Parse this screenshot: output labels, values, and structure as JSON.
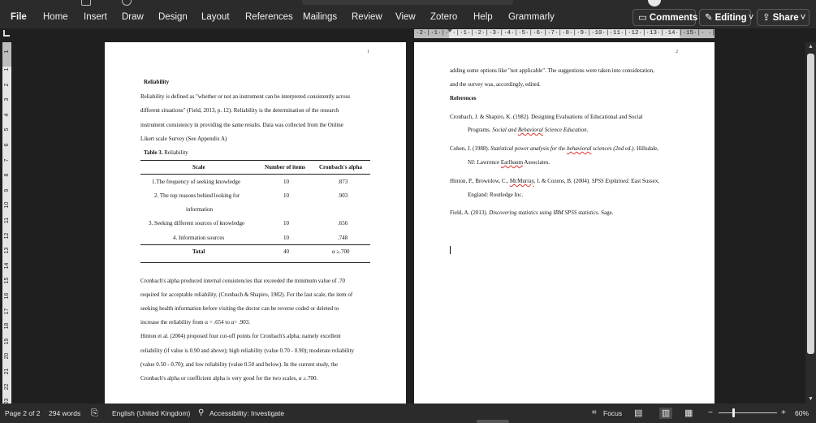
{
  "ribbon": {
    "tabs": [
      "File",
      "Home",
      "Insert",
      "Draw",
      "Design",
      "Layout",
      "References",
      "Mailings",
      "Review",
      "View",
      "Zotero",
      "Help",
      "Grammarly"
    ],
    "comments_label": "Comments",
    "editing_label": "Editing",
    "share_label": "Share"
  },
  "ruler": {
    "horizontal": "·2·|·1·|·   ·|·1·|·2·|·3·|·4·|·5·|·6·|·7·|·8·|·9·|·10·|·11·|·12·|·13·|·14·|·15·|·  ·|·17·|·18",
    "vertical": [
      "1",
      "1",
      "2",
      "3",
      "4",
      "5",
      "6",
      "7",
      "8",
      "9",
      "10",
      "11",
      "12",
      "13",
      "14",
      "15",
      "16",
      "17",
      "18",
      "19",
      "20",
      "21",
      "22",
      "23"
    ]
  },
  "page1": {
    "page_number": "1",
    "heading": "Reliability",
    "para1": [
      "Reliability is defined as \"whether or not an instrument can be interpreted consistently across",
      "different situations\" (Field, 2013, p. 12).  Reliability is the determination of the research",
      "instrument consistency in providing the same results. Data was collected from the Online",
      "Likert scale Survey (See Appendix A)"
    ],
    "table_caption_bold": "Table 3.",
    "table_caption_rest": " Reliability",
    "table": {
      "headers": [
        "Scale",
        "Number of items",
        "Cronbach's alpha"
      ],
      "rows": [
        {
          "scale": "1.The frequency of seeking knowledge",
          "items": "10",
          "alpha": ".873"
        },
        {
          "scale": "2. The top reasons behind looking for",
          "scale_cont": "information",
          "items": "10",
          "alpha": ".903"
        },
        {
          "scale": "3. Seeking different sources of knowledge",
          "items": "10",
          "alpha": ".656"
        },
        {
          "scale": "4. Information sources",
          "items": "10",
          "alpha": ".748"
        }
      ],
      "total": {
        "scale": "Total",
        "items": "40",
        "alpha": "α ≥.700"
      }
    },
    "para2": [
      "Cronbach's alpha produced internal consistencies that exceeded the minimum value of .70",
      "required for acceptable reliability, (Cronbach & Shapiro, 1982). For the last scale, the item of",
      "seeking health information before visiting the doctor can be reverse coded or deleted to",
      "increase the reliability from α = .654 to α= .903.",
      "Hinton et al. (2004) proposed four cut-off points for Cronbach's alpha; namely excellent",
      "reliability (if value is 0.90 and above); high reliability (value 0.70 - 0.90); moderate reliability",
      "(value 0.50 - 0.70); and low reliability (value 0.50 and below). In the current study, the",
      "Cronbach's alpha or coefficient alpha is very good for the two scales, α ≥.700."
    ]
  },
  "page2": {
    "page_number": "2",
    "top_lines": [
      "adding some options like \"not applicable\". The suggestions were taken into consideration,",
      "and the survey was, accordingly, edited."
    ],
    "references_heading": "References",
    "ref1": {
      "line1": "Cronbach, J. & Shapiro, K. (1982). Designing Evaluations of Educational and Social",
      "line2_a": "Programs. ",
      "line2_i1": "Social and ",
      "line2_sq": "Behavioral",
      "line2_i2": " Science Education."
    },
    "ref2": {
      "a": "Cohen, J. (1988). ",
      "i1": "Statistical power analysis for the ",
      "sq": "behavioral",
      "i2": " sciences (2nd ed.).",
      "b": " Hillsdale,",
      "line2_a": "NJ: Lawrence ",
      "line2_sq": "Earlbaum",
      "line2_b": " Associates."
    },
    "ref3": {
      "a": "Hinton, P., Brownlow, C., ",
      "sq": "McMurray",
      "b": ", I. & Cozens, B. (2004). ",
      "i": "SPSS Explained.",
      "c": " East Sussex,",
      "line2": "England: Routledge Inc."
    },
    "ref4": {
      "a": "Field, A. (2013). ",
      "i": "Discovering statistics using IBM SPSS statistics.",
      "b": " Sage."
    }
  },
  "status": {
    "page": "Page 2 of 2",
    "words": "294 words",
    "language": "English (United Kingdom)",
    "accessibility": "Accessibility: Investigate",
    "focus": "Focus",
    "zoom_minus": "−",
    "zoom_plus": "+",
    "zoom": "60%"
  }
}
